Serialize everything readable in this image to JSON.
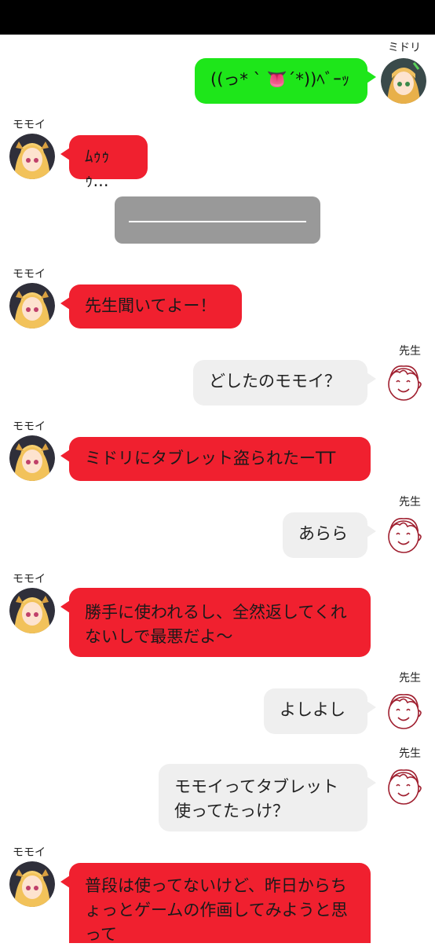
{
  "chat": {
    "names": {
      "midori": "ミドリ",
      "momoi": "モモイ",
      "sensei": "先生"
    },
    "messages": [
      {
        "text": "((っ* ` 👅´*))ﾍﾞｰｯ"
      },
      {
        "text": "ﾑｩｩｩ..."
      },
      {
        "text": "先生聞いてよー！"
      },
      {
        "text": "どしたのモモイ？"
      },
      {
        "text": "ミドリにタブレット盗られたーTT"
      },
      {
        "text": "あらら"
      },
      {
        "text": "勝手に使われるし、全然返してくれないしで最悪だよ～"
      },
      {
        "text": "よしよし"
      },
      {
        "text": "モモイってタブレット使ってたっけ？"
      },
      {
        "text": "普段は使ってないけど、昨日からちょっとゲームの作画してみようと思って"
      }
    ]
  },
  "colors": {
    "momoi_bubble": "#f0202f",
    "midori_bubble": "#1ee61a",
    "sensei_bubble": "#efefef",
    "divider": "#999999",
    "topbar": "#000000"
  }
}
